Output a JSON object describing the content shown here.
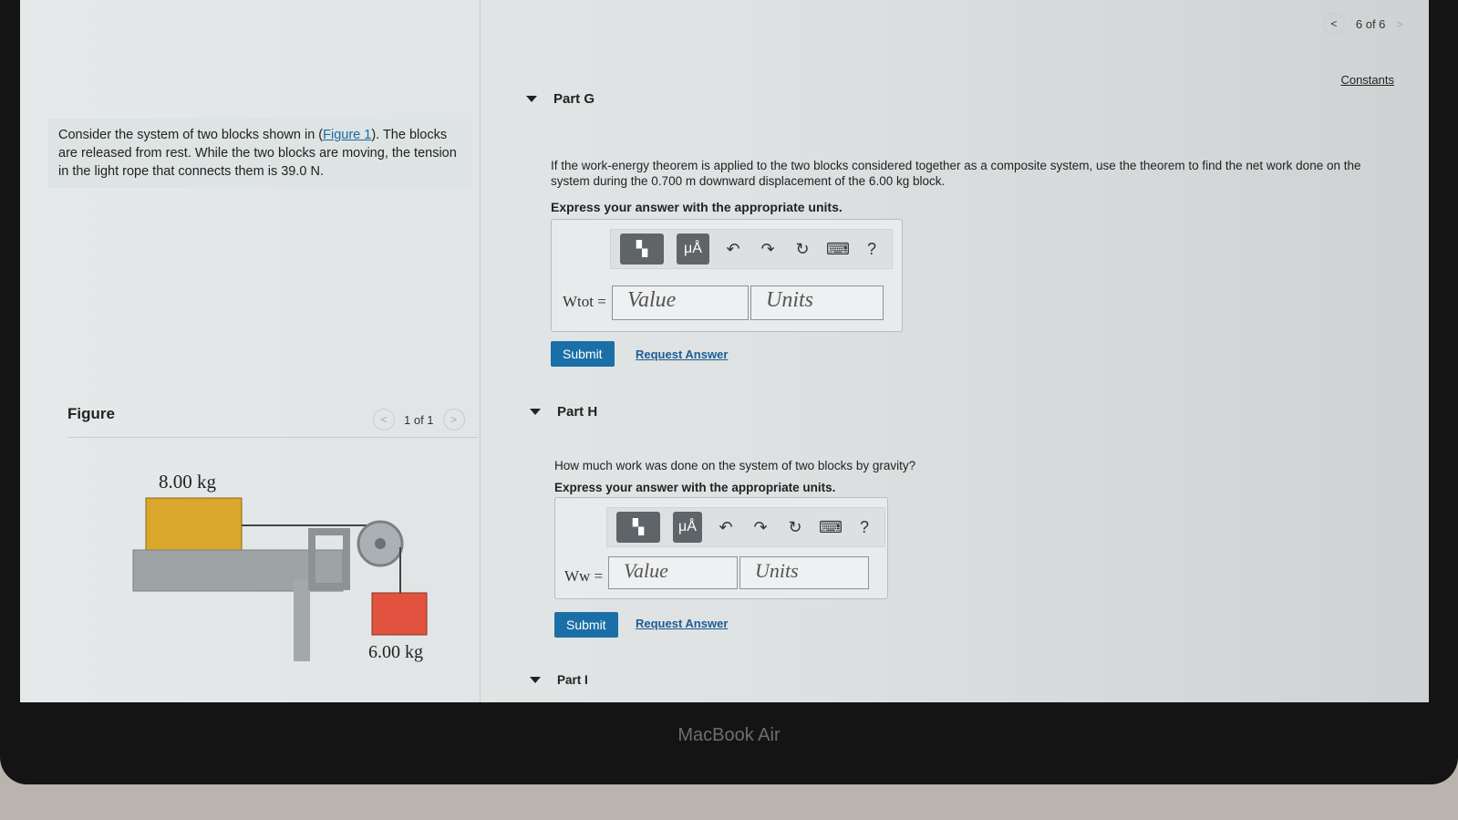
{
  "nav": {
    "pager": "6 of 6",
    "prev_icon": "chevron-left-icon",
    "next_icon": "chevron-right-icon",
    "constants": "Constants"
  },
  "intro": {
    "text_before": "Consider the system of two blocks shown in (",
    "link": "Figure 1",
    "text_after": "). The blocks are released from rest. While the two blocks are moving, the tension in the light rope that connects them is 39.0 N."
  },
  "figure": {
    "title": "Figure",
    "pager": "1 of 1",
    "mass_top": "8.00 kg",
    "mass_hanging": "6.00 kg",
    "colors": {
      "block_top": "#d9a72b",
      "block_hanging": "#e2533f"
    }
  },
  "toolbar": {
    "templates": "templates-icon",
    "units": "μÅ",
    "undo": "undo-icon",
    "redo": "redo-icon",
    "reset": "reset-icon",
    "keyboard": "keyboard-icon",
    "help": "?"
  },
  "parts": [
    {
      "title": "Part G",
      "question": "If the work-energy theorem is applied to the two blocks considered together as a composite system, use the theorem to find the net work done on the system during the 0.700 m downward displacement of the 6.00 kg block.",
      "instruction": "Express your answer with the appropriate units.",
      "var_label": "Wtot =",
      "value_placeholder": "Value",
      "units_placeholder": "Units",
      "submit": "Submit",
      "request": "Request Answer"
    },
    {
      "title": "Part H",
      "question": "How much work was done on the system of two blocks by gravity?",
      "instruction": "Express your answer with the appropriate units.",
      "var_label": "Ww =",
      "value_placeholder": "Value",
      "units_placeholder": "Units",
      "submit": "Submit",
      "request": "Request Answer"
    },
    {
      "title": "Part I"
    }
  ],
  "device": {
    "brand": "MacBook Air"
  },
  "accent": "#1b6fa7"
}
